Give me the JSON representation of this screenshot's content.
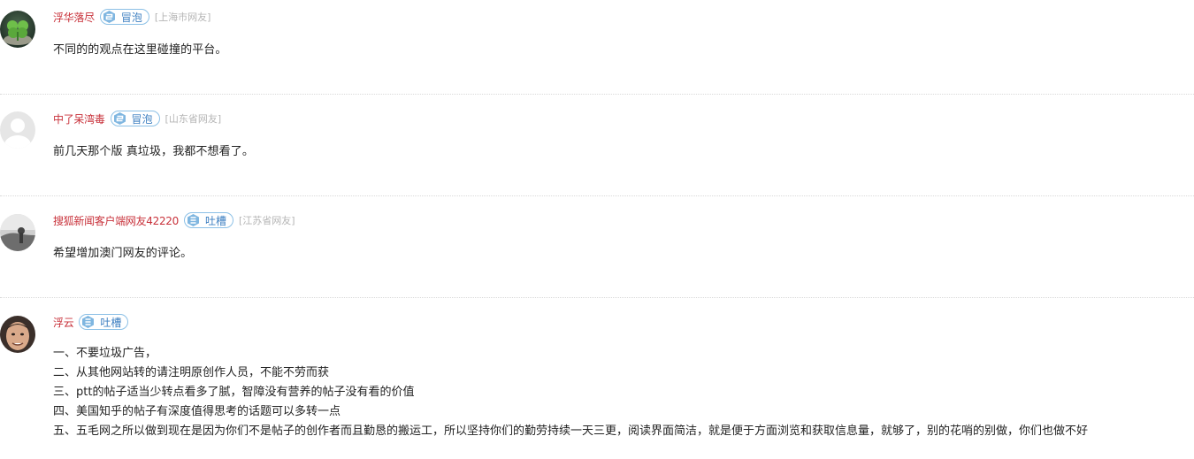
{
  "comments": [
    {
      "user": "浮华落尽",
      "badge": "冒泡",
      "location": "[上海市网友]",
      "text": "不同的的观点在这里碰撞的平台。",
      "avatar": "clover-avatar"
    },
    {
      "user": "中了呆湾毒",
      "badge": "冒泡",
      "location": "[山东省网友]",
      "text": "前几天那个版 真垃圾，我都不想看了。",
      "avatar": "default-avatar"
    },
    {
      "user": "搜狐新闻客户端网友42220",
      "badge": "吐槽",
      "location": "[江苏省网友]",
      "text": "希望增加澳门网友的评论。",
      "avatar": "photo-avatar"
    },
    {
      "user": "浮云",
      "badge": "吐槽",
      "location": "",
      "lines": [
        "一、不要垃圾广告，",
        "二、从其他网站转的请注明原创作人员，不能不劳而获",
        "三、ptt的帖子适当少转点看多了腻，智障没有营养的帖子没有看的价值",
        "四、美国知乎的帖子有深度值得思考的话题可以多转一点",
        "五、五毛网之所以做到现在是因为你们不是帖子的创作者而且勤恳的搬运工，所以坚持你们的勤劳持续一天三更，阅读界面简洁，就是便于方面浏览和获取信息量，就够了，别的花哨的别做，你们也做不好"
      ],
      "avatar": "face-avatar"
    }
  ],
  "colors": {
    "username": "#c8313a",
    "badge_border": "#8cc0e6",
    "badge_text": "#3d7fc1",
    "location": "#b5b5b5",
    "divider": "#d9d9d9"
  }
}
